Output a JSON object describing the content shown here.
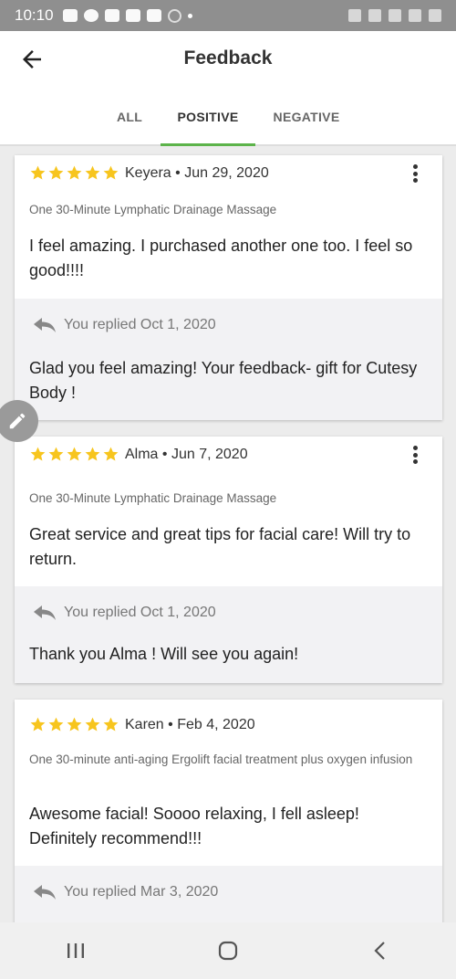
{
  "status_bar": {
    "time": "10:10"
  },
  "header": {
    "title": "Feedback"
  },
  "tabs": [
    {
      "label": "ALL"
    },
    {
      "label": "POSITIVE"
    },
    {
      "label": "NEGATIVE"
    }
  ],
  "active_tab": "POSITIVE",
  "reviews": [
    {
      "rating": 5,
      "author": "Keyera",
      "date": "Jun 29, 2020",
      "service": "One 30-Minute Lymphatic Drainage Massage",
      "text": "I feel amazing. I purchased another one too. I feel so good!!!!",
      "reply_header": "You replied Oct 1, 2020",
      "reply_text": "Glad you feel amazing! Your feedback- gift for Cutesy Body !"
    },
    {
      "rating": 5,
      "author": "Alma",
      "date": "Jun 7, 2020",
      "service": "One 30-Minute Lymphatic Drainage Massage",
      "text": "Great service and great tips for facial care! Will try to return.",
      "reply_header": "You replied Oct 1, 2020",
      "reply_text": "Thank you Alma ! Will see you again!"
    },
    {
      "rating": 5,
      "author": "Karen",
      "date": "Feb 4, 2020",
      "service": "One 30-minute anti-aging Ergolift facial treatment plus oxygen infusion",
      "text": "Awesome facial!  Soooo relaxing, I fell asleep! Definitely recommend!!!",
      "reply_header": "You replied Mar 3, 2020",
      "reply_text": ""
    }
  ],
  "separator": "•",
  "colors": {
    "accent": "#5cb34a",
    "star": "#f7c51e"
  },
  "icons": {
    "back": "back-arrow-icon",
    "more": "more-vert-icon",
    "reply": "reply-icon",
    "edit": "pencil-icon"
  }
}
